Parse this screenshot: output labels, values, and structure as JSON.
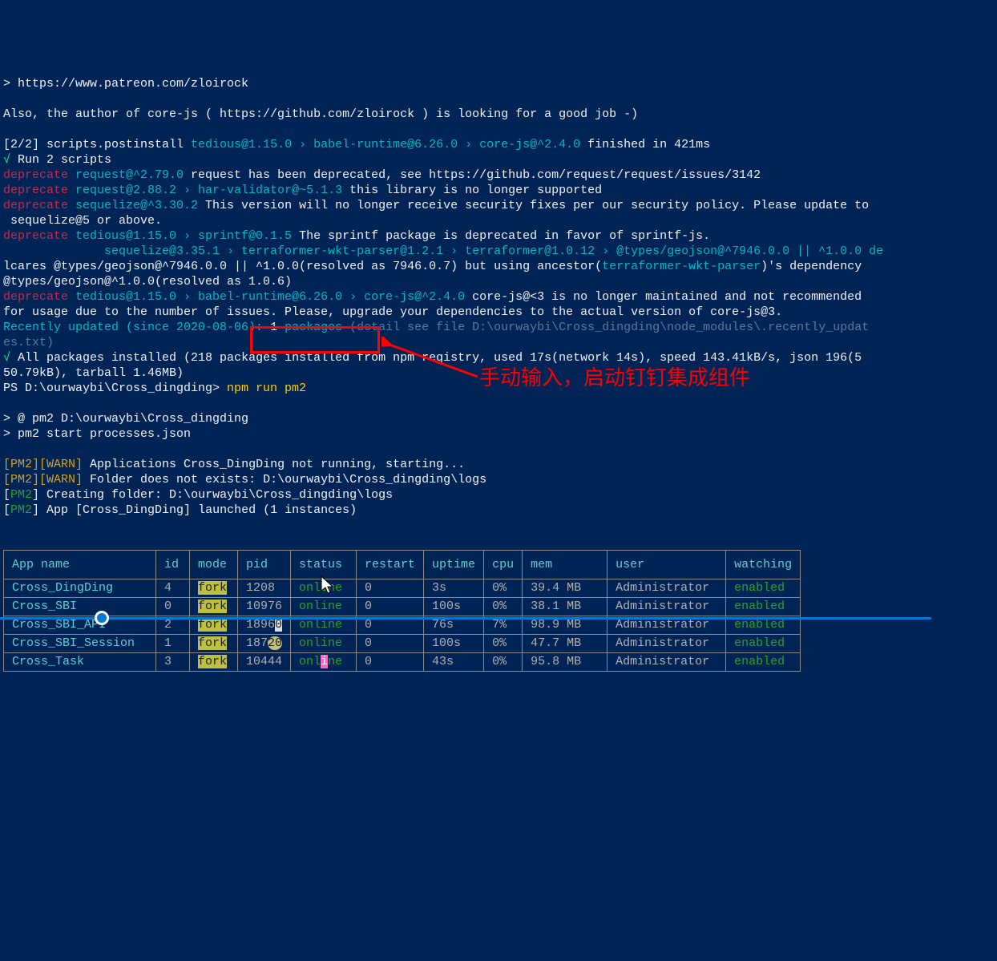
{
  "lines": {
    "patreon": "> https://www.patreon.com/zloirock",
    "author": "Also, the author of core-js ( https://github.com/zloirock ) is looking for a good job -)",
    "postinstall_prefix": "[2/2] scripts.postinstall ",
    "postinstall_chain": "tedious@1.15.0 › babel-runtime@6.26.0 › core-js@^2.4.0",
    "postinstall_suffix": " finished in 421ms",
    "check": "√",
    "run2": " Run 2 scripts",
    "dep1a": "deprecate",
    "dep1b": " request@^2.79.0 ",
    "dep1c": "request has been deprecated, see https://github.com/request/request/issues/3142",
    "dep2a": "deprecate",
    "dep2b": " request@2.88.2 › har-validator@~5.1.3 ",
    "dep2c": "this library is no longer supported",
    "dep3a": "deprecate",
    "dep3b": " sequelize@^3.30.2 ",
    "dep3c": "This version will no longer receive security fixes per our security policy. Please update to",
    "dep3d": " sequelize@5 or above.",
    "dep4a": "deprecate",
    "dep4b": " tedious@1.15.0 › sprintf@0.1.5 ",
    "dep4c": "The sprintf package is deprecated in favor of sprintf-js.",
    "types1": "              sequelize@3.35.1 › terraformer-wkt-parser@1.2.1 › terraformer@1.0.12 › @types/geojson@^7946.0.0 || ^1.0.0 de",
    "types2": "lcares @types/geojson@^7946.0.0 || ^1.0.0(resolved as 7946.0.7) but using ancestor(",
    "types2b": "terraformer-wkt-parser",
    "types2c": ")'s dependency ",
    "types3": "@types/geojson@^1.0.0(resolved as 1.0.6)",
    "dep5a": "deprecate",
    "dep5b": " tedious@1.15.0 › babel-runtime@6.26.0 › core-js@^2.4.0 ",
    "dep5c": "core-js@<3 is no longer maintained and not recommended ",
    "dep5d": "for usage due to the number of issues. Please, upgrade your dependencies to the actual version of core-js@3.",
    "recent1": "Recently updated (since 2020-08-06): ",
    "recent1b": "1",
    "recent1c": " packages",
    "recent1d": " (detail see file D:\\ourwaybi\\Cross_dingding\\node_modules\\.recently_updat",
    "recent2": "es.txt)",
    "all1": " All packages installed (218 packages installed from npm registry, used 17s(network 14s), speed 143.41kB/s, json 196(5",
    "all2": "50.79kB), tarball 1.46MB)",
    "ps_prompt": "PS D:\\ourwaybi\\Cross_dingding>",
    "cmd": " npm run pm2",
    "pm2_line1": "> @ pm2 D:\\ourwaybi\\Cross_dingding",
    "pm2_line2": "> pm2 start processes.json",
    "warn1a": "[PM2][WARN]",
    "warn1b": " Applications Cross_DingDing not running, starting...",
    "warn2a": "[PM2][WARN]",
    "warn2b": " Folder does not exists: D:\\ourwaybi\\Cross_dingding\\logs",
    "info1a": "[",
    "info1pm2": "PM2",
    "info1b": "] Creating folder: D:\\ourwaybi\\Cross_dingding\\logs",
    "info2b": "] App [Cross_DingDing] launched (1 instances)"
  },
  "annotation": "手动输入，启动钉钉集成组件",
  "table": {
    "headers": [
      "App name",
      "id",
      "mode",
      "pid",
      "status",
      "restart",
      "uptime",
      "cpu",
      "mem",
      "user",
      "watching"
    ],
    "rows": [
      {
        "name": "Cross_DingDing",
        "id": "4",
        "mode": "fork",
        "pid": "1208",
        "status": "online",
        "restart": "0",
        "uptime": "3s",
        "cpu": "0%",
        "mem": "39.4 MB",
        "user": "Administrator",
        "watching": "enabled",
        "hl": "fork"
      },
      {
        "name": "Cross_SBI",
        "id": "0",
        "mode": "fork",
        "pid": "10976",
        "status": "online",
        "restart": "0",
        "uptime": "100s",
        "cpu": "0%",
        "mem": "38.1 MB",
        "user": "Administrator",
        "watching": "enabled",
        "hl": "fork"
      },
      {
        "name": "Cross_SBI_API",
        "id": "2",
        "mode": "fork",
        "pid": "18960",
        "status": "online",
        "restart": "0",
        "uptime": "76s",
        "cpu": "7%",
        "mem": "98.9 MB",
        "user": "Administrator",
        "watching": "enabled",
        "hl": "pid"
      },
      {
        "name": "Cross_SBI_Session",
        "id": "1",
        "mode": "fork",
        "pid": "18720",
        "status": "online",
        "restart": "0",
        "uptime": "100s",
        "cpu": "0%",
        "mem": "47.7 MB",
        "user": "Administrator",
        "watching": "enabled",
        "hl": "pid2"
      },
      {
        "name": "Cross_Task",
        "id": "3",
        "mode": "fork",
        "pid": "10444",
        "status": "online",
        "restart": "0",
        "uptime": "43s",
        "cpu": "0%",
        "mem": "95.8 MB",
        "user": "Administrator",
        "watching": "enabled",
        "hl": "pink"
      }
    ]
  }
}
